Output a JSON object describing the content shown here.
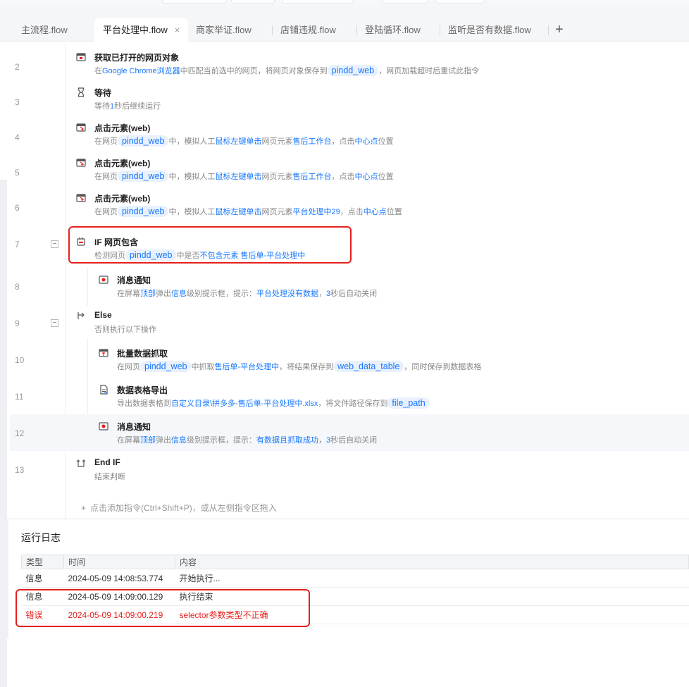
{
  "tabs": [
    {
      "label": "主流程.flow",
      "active": false
    },
    {
      "label": "平台处理中.flow",
      "active": true,
      "close": "×"
    },
    {
      "label": "商家举证.flow",
      "active": false
    },
    {
      "label": "店铺违规.flow",
      "active": false
    },
    {
      "label": "登陆循环.flow",
      "active": false
    },
    {
      "label": "监听是否有数据.flow",
      "active": false
    }
  ],
  "tab_add": "+",
  "rows": [
    {
      "no": "2",
      "title": "获取已打开的网页对象",
      "d": [
        "在",
        "Google Chrome浏览器",
        "中匹配当前选中的网页，将网页对象保存到",
        "pindd_web",
        "，网页加载超时后重试此指令"
      ]
    },
    {
      "no": "3",
      "title": "等待",
      "d": [
        "等待",
        "1",
        "秒后继续运行"
      ]
    },
    {
      "no": "4",
      "title": "点击元素(web)",
      "d": [
        "在网页",
        "pindd_web",
        "中，模拟人工",
        "鼠标左键单击",
        "网页元素",
        "售后工作台",
        "，点击",
        "中心点",
        "位置"
      ]
    },
    {
      "no": "5",
      "title": "点击元素(web)",
      "d": [
        "在网页",
        "pindd_web",
        "中，模拟人工",
        "鼠标左键单击",
        "网页元素",
        "售后工作台",
        "，点击",
        "中心点",
        "位置"
      ]
    },
    {
      "no": "6",
      "title": "点击元素(web)",
      "d": [
        "在网页",
        "pindd_web",
        "中，模拟人工",
        "鼠标左键单击",
        "网页元素",
        "平台处理中29",
        "，点击",
        "中心点",
        "位置"
      ]
    },
    {
      "no": "7",
      "title": "IF 网页包含",
      "fold": "−",
      "d": [
        "检测网页",
        "pindd_web",
        "中是否",
        "不包含元素",
        " ",
        "售后单-平台处理中"
      ]
    },
    {
      "no": "8",
      "title": "消息通知",
      "d": [
        "在屏幕",
        "顶部",
        "弹出",
        "信息",
        "级别提示框，提示：",
        "平台处理没有数据",
        "，",
        "3",
        "秒后自动关闭"
      ]
    },
    {
      "no": "9",
      "title": "Else",
      "fold": "−",
      "d": [
        "否则执行以下操作"
      ]
    },
    {
      "no": "10",
      "title": "批量数据抓取",
      "d": [
        "在网页",
        "pindd_web",
        "中抓取",
        "售后单-平台处理中",
        "，将结果保存到",
        "web_data_table",
        "，同时保存到数据表格"
      ]
    },
    {
      "no": "11",
      "title": "数据表格导出",
      "d": [
        "导出数据表格到",
        "自定义目录\\拼多多-售后单-平台处理中.xlsx",
        "，将文件路径保存到",
        "file_path"
      ]
    },
    {
      "no": "12",
      "title": "消息通知",
      "d": [
        "在屏幕",
        "顶部",
        "弹出",
        "信息",
        "级别提示框，提示：",
        "有数据且抓取成功",
        "，",
        "3",
        "秒后自动关闭"
      ]
    },
    {
      "no": "13",
      "title": "End IF",
      "d": [
        "结束判断"
      ]
    }
  ],
  "add_hint": "点击添加指令(Ctrl+Shift+P)，或从左侧指令区拖入",
  "add_plus": "+",
  "log": {
    "title": "运行日志",
    "headers": [
      "类型",
      "时间",
      "内容"
    ],
    "rows": [
      {
        "type": "信息",
        "time": "2024-05-09 14:08:53.774",
        "content": "开始执行..."
      },
      {
        "type": "信息",
        "time": "2024-05-09 14:09:00.129",
        "content": "执行结束"
      },
      {
        "type": "错误",
        "time": "2024-05-09 14:09:00.219",
        "content": "selector参数类型不正确"
      }
    ]
  },
  "colors": {
    "accent": "#1677ff",
    "error": "#e5201b",
    "chip_bg": "#e8f1fd"
  }
}
